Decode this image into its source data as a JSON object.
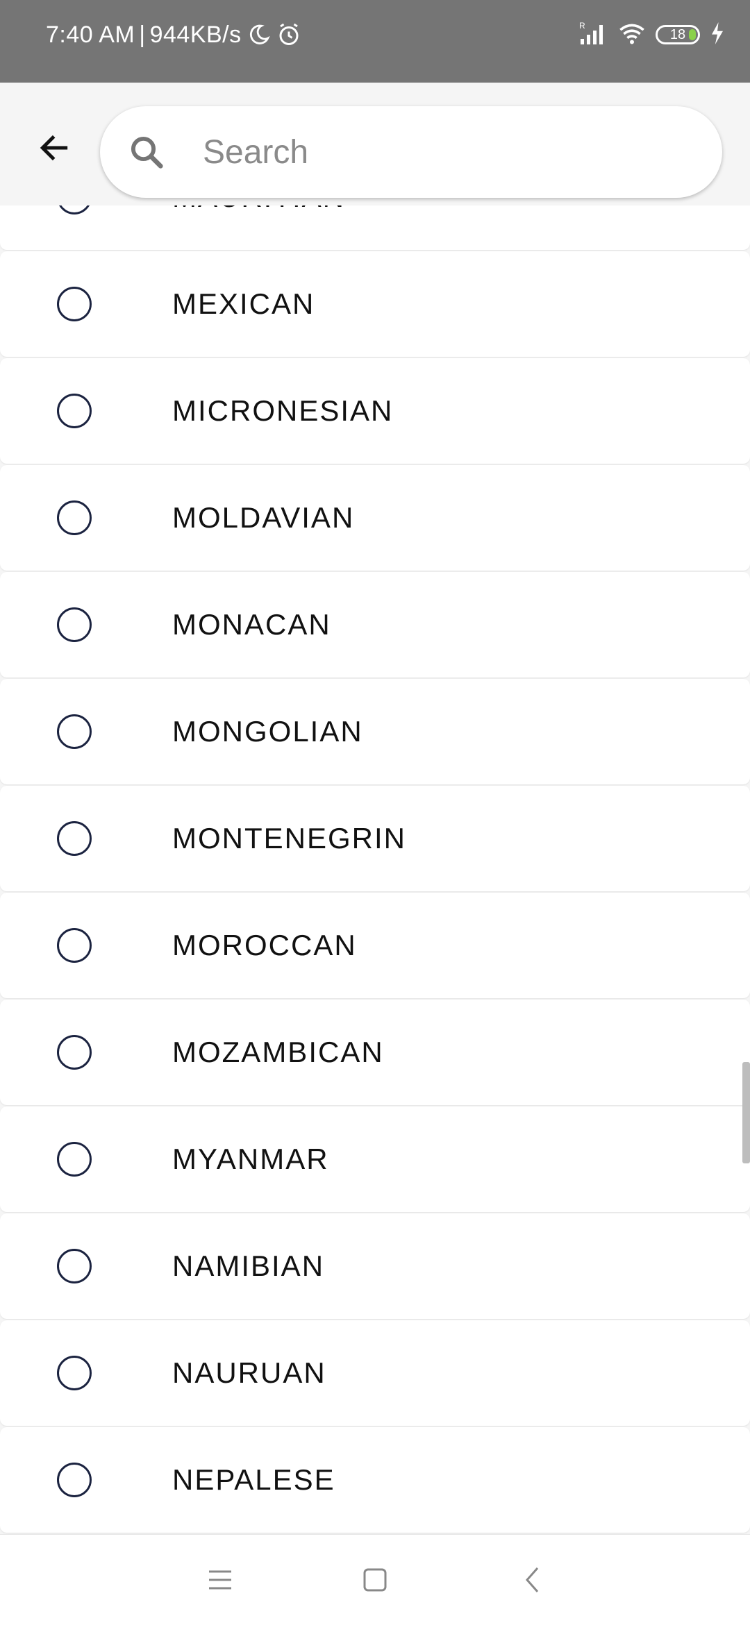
{
  "status_bar": {
    "time": "7:40 AM",
    "speed": "944KB/s",
    "battery_level": "18",
    "icons": [
      "moon-icon",
      "alarm-icon",
      "signal-icon",
      "wifi-icon",
      "battery-icon",
      "charging-icon"
    ]
  },
  "header": {
    "back_icon": "arrow-left-icon",
    "search": {
      "placeholder": "Search",
      "value": "",
      "icon": "search-icon"
    }
  },
  "list": {
    "items": [
      {
        "label": "MAURITIAN",
        "selected": false
      },
      {
        "label": "MEXICAN",
        "selected": false
      },
      {
        "label": "MICRONESIAN",
        "selected": false
      },
      {
        "label": "MOLDAVIAN",
        "selected": false
      },
      {
        "label": "MONACAN",
        "selected": false
      },
      {
        "label": "MONGOLIAN",
        "selected": false
      },
      {
        "label": "MONTENEGRIN",
        "selected": false
      },
      {
        "label": "MOROCCAN",
        "selected": false
      },
      {
        "label": "MOZAMBICAN",
        "selected": false
      },
      {
        "label": "MYANMAR",
        "selected": false
      },
      {
        "label": "NAMIBIAN",
        "selected": false
      },
      {
        "label": "NAURUAN",
        "selected": false
      },
      {
        "label": "NEPALESE",
        "selected": false
      }
    ]
  },
  "nav_bar": {
    "icons": [
      "menu-icon",
      "home-icon",
      "back-icon"
    ]
  },
  "colors": {
    "status_bar_bg": "#757575",
    "header_bg": "#f5f5f5",
    "radio_border": "#1b2340",
    "battery_fill": "#8bd14a"
  }
}
